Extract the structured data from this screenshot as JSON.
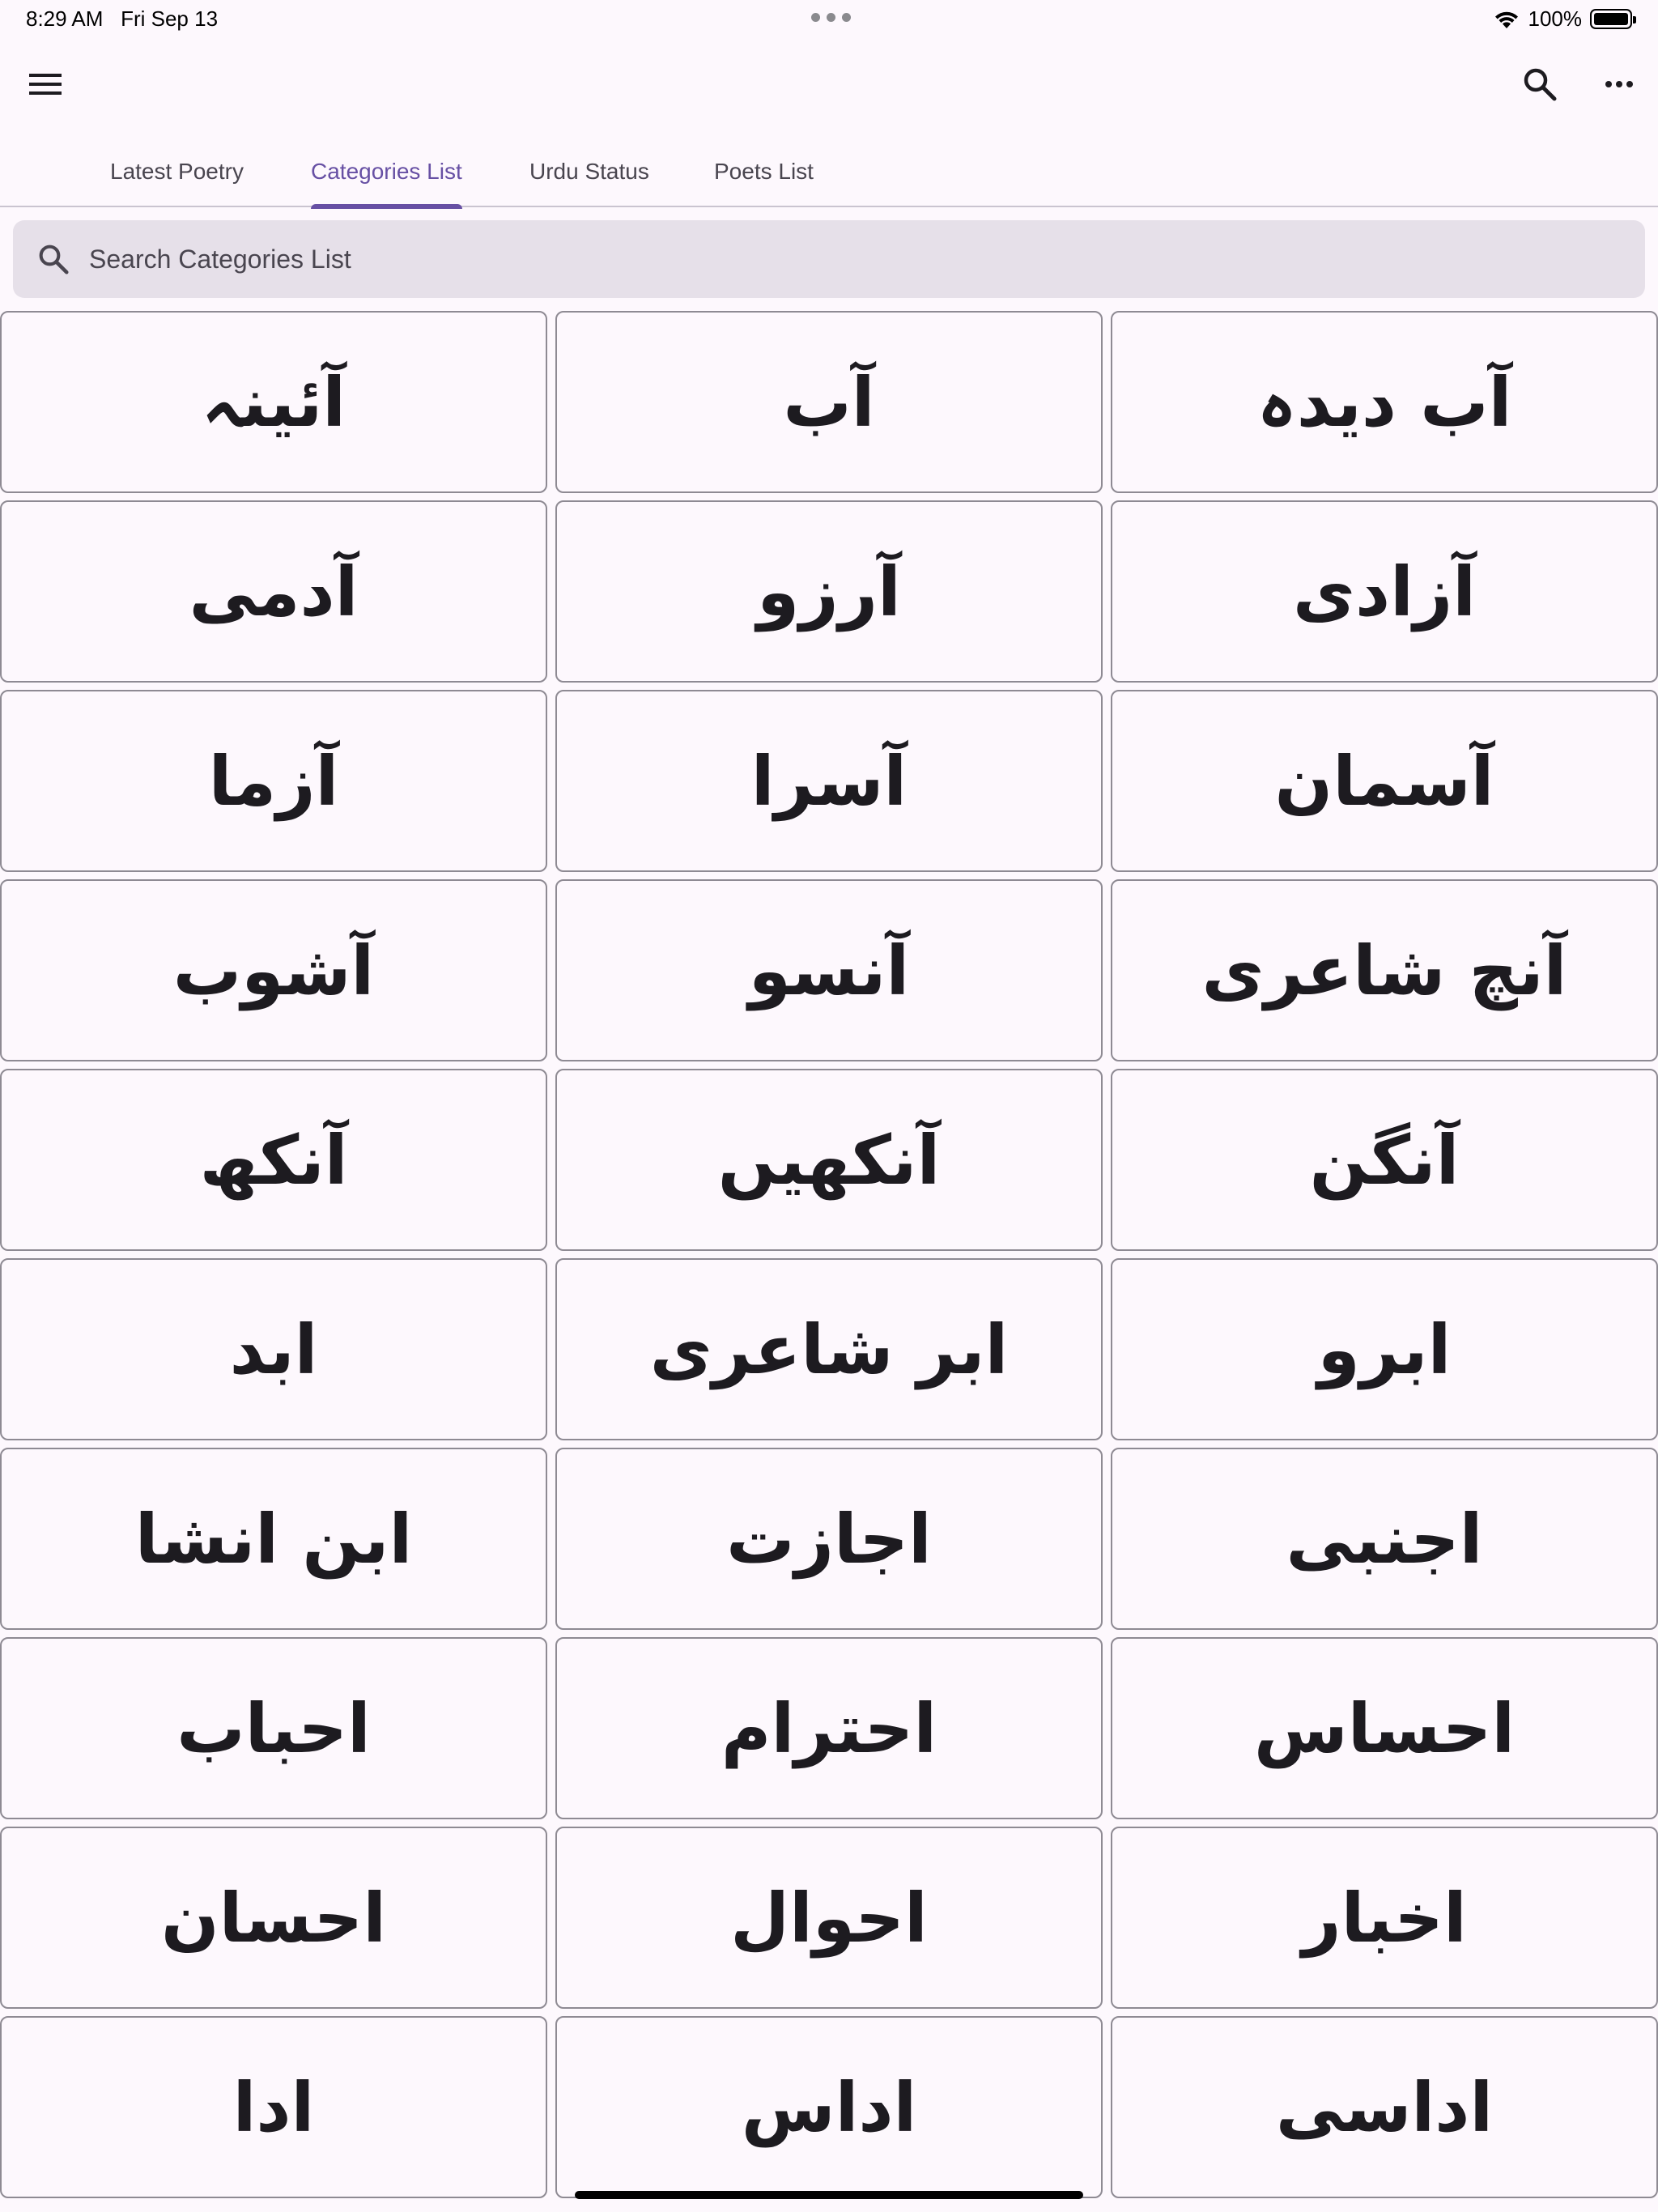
{
  "status_bar": {
    "time": "8:29 AM",
    "date": "Fri Sep 13",
    "battery": "100%"
  },
  "app_bar": {
    "icons": [
      "menu-icon",
      "search-icon",
      "more-horizontal-icon"
    ]
  },
  "tabs": [
    {
      "label": "Latest Poetry",
      "active": false
    },
    {
      "label": "Categories List",
      "active": true
    },
    {
      "label": "Urdu Status",
      "active": false
    },
    {
      "label": "Poets List",
      "active": false
    }
  ],
  "search": {
    "placeholder": "Search Categories List",
    "value": ""
  },
  "categories": [
    "آئینہ",
    "آب",
    "آب دیدہ",
    "آدمی",
    "آرزو",
    "آزادی",
    "آزما",
    "آسرا",
    "آسمان",
    "آشوب",
    "آنسو",
    "آنچ شاعری",
    "آنکھ",
    "آنکھیں",
    "آنگن",
    "ابد",
    "ابر شاعری",
    "ابرو",
    "ابن انشا",
    "اجازت",
    "اجنبی",
    "احباب",
    "احترام",
    "احساس",
    "احسان",
    "احوال",
    "اخبار",
    "ادا",
    "اداس",
    "اداسی"
  ],
  "colors": {
    "accent": "#6750a4",
    "background": "#fdf8fd",
    "card_border": "#8e8a93",
    "search_bg": "#e6e0e9"
  }
}
